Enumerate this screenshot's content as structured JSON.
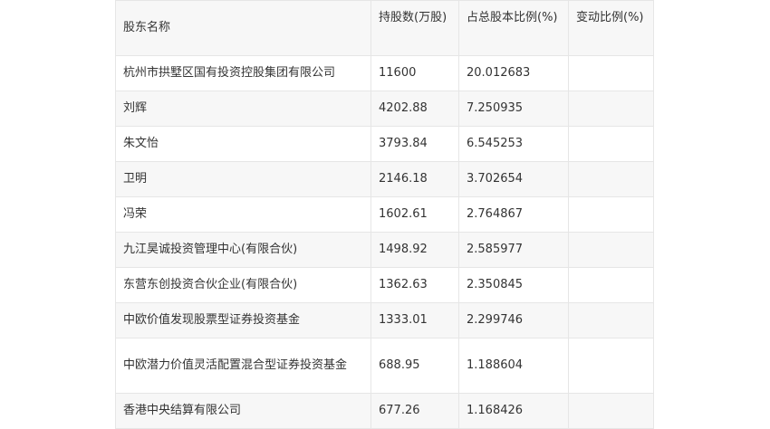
{
  "table": {
    "headers": [
      "股东名称",
      "持股数(万股)",
      "占总股本比例(%)",
      "变动比例(%)"
    ],
    "rows": [
      [
        "杭州市拱墅区国有投资控股集团有限公司",
        "11600",
        "20.012683",
        ""
      ],
      [
        "刘辉",
        "4202.88",
        "7.250935",
        ""
      ],
      [
        "朱文怡",
        "3793.84",
        "6.545253",
        ""
      ],
      [
        "卫明",
        "2146.18",
        "3.702654",
        ""
      ],
      [
        "冯荣",
        "1602.61",
        "2.764867",
        ""
      ],
      [
        "九江昊诚投资管理中心(有限合伙)",
        "1498.92",
        "2.585977",
        ""
      ],
      [
        "东营东创投资合伙企业(有限合伙)",
        "1362.63",
        "2.350845",
        ""
      ],
      [
        "中欧价值发现股票型证券投资基金",
        "1333.01",
        "2.299746",
        ""
      ],
      [
        "中欧潜力价值灵活配置混合型证券投资基金",
        "688.95",
        "1.188604",
        ""
      ],
      [
        "香港中央结算有限公司",
        "677.26",
        "1.168426",
        ""
      ]
    ]
  }
}
